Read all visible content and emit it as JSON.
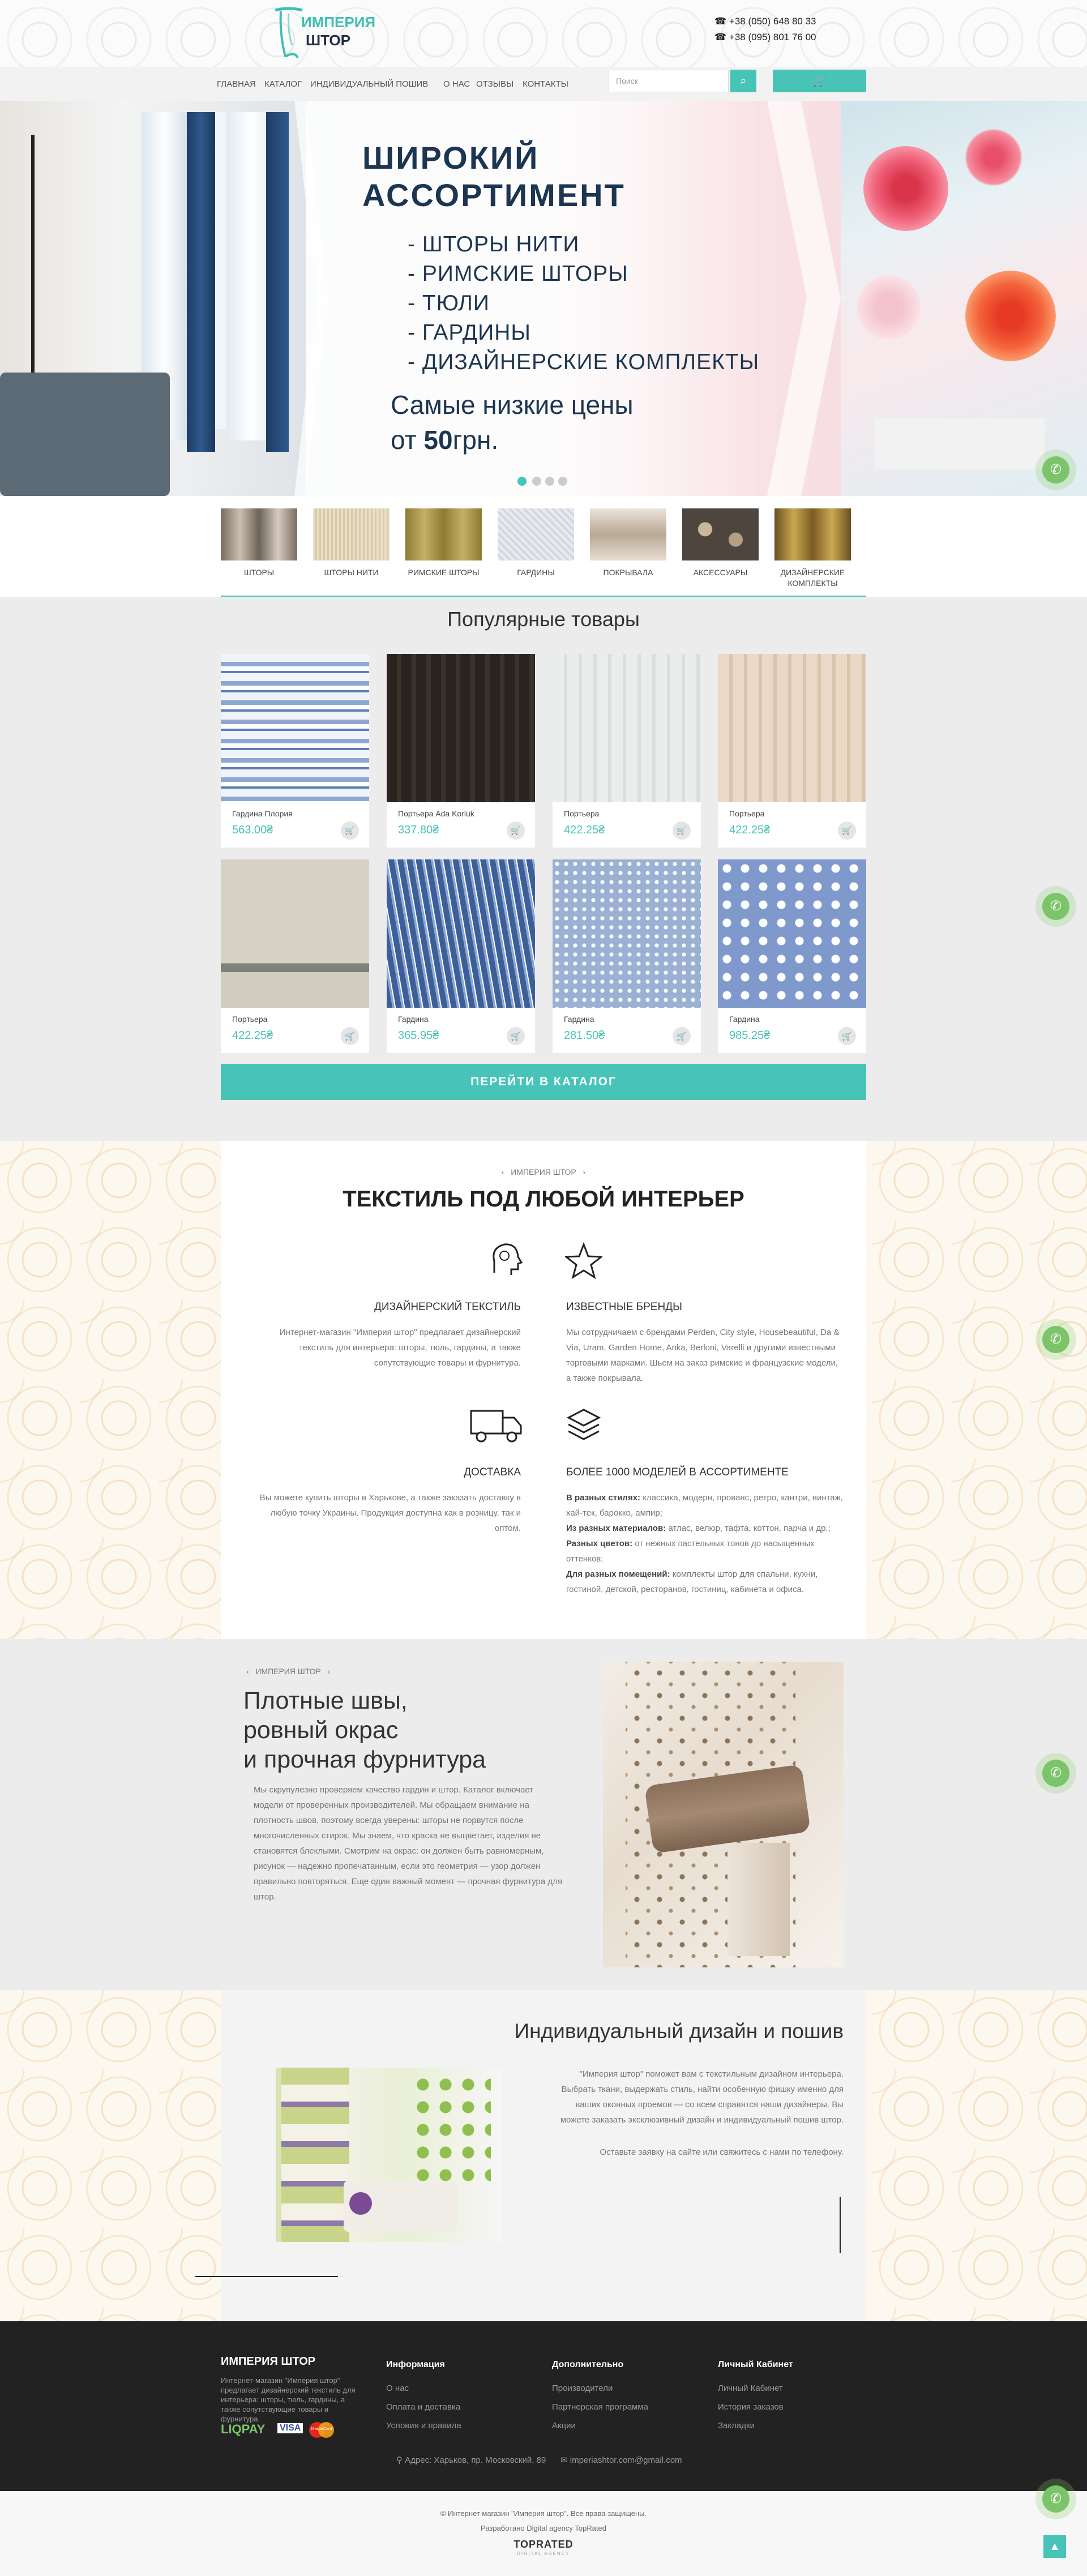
{
  "header": {
    "logo_line1": "ИМПЕРИЯ",
    "logo_line2": "ШТОР",
    "phone1": "+38 (050) 648 80 33",
    "phone2": "+38 (095) 801 76 00"
  },
  "nav": {
    "items": [
      "ГЛАВНАЯ",
      "КАТАЛОГ",
      "ИНДИВИДУАЛЬНЫЙ ПОШИВ",
      "О НАС",
      "ОТЗЫВЫ",
      "КОНТАКТЫ"
    ],
    "search_placeholder": "Поиск",
    "search_icon": "search-icon",
    "cart_icon": "cart-icon"
  },
  "hero": {
    "heading_line1": "ШИРОКИЙ",
    "heading_line2": "АССОРТИМЕНТ",
    "list": [
      "- ШТОРЫ НИТИ",
      "- РИМСКИЕ ШТОРЫ",
      "- ТЮЛИ",
      "- ГАРДИНЫ",
      "- ДИЗАЙНЕРСКИЕ КОМПЛЕКТЫ"
    ],
    "price_line1": "Самые низкие цены",
    "price_line2_prefix": "от ",
    "price_value": "50",
    "price_currency": "грн.",
    "active_slide": 1,
    "slide_count": 4
  },
  "categories": [
    {
      "label": "ШТОРЫ",
      "color": "#8a7d70"
    },
    {
      "label": "ШТОРЫ НИТИ",
      "color": "#e0d3b8"
    },
    {
      "label": "РИМСКИЕ ШТОРЫ",
      "color": "#b9a25a"
    },
    {
      "label": "ГАРДИНЫ",
      "color": "#d9dde3"
    },
    {
      "label": "ПОКРЫВАЛА",
      "color": "#c8b9a8"
    },
    {
      "label": "АКСЕССУАРЫ",
      "color": "#6e6258"
    },
    {
      "label": "ДИЗАЙНЕРСКИЕ КОМПЛЕКТЫ",
      "color": "#9a7a3a"
    }
  ],
  "popular": {
    "title": "Популярные товары",
    "products": [
      {
        "name": "Гардина Плория",
        "price": "563.00₴",
        "color": "#9fb4d6"
      },
      {
        "name": "Портьера Ada Korluk",
        "price": "337.80₴",
        "color": "#2c2725"
      },
      {
        "name": "Портьера",
        "price": "422.25₴",
        "color": "#e3e8e6"
      },
      {
        "name": "Портьера",
        "price": "422.25₴",
        "color": "#e6d6c4"
      },
      {
        "name": "Портьера",
        "price": "422.25₴",
        "color": "#cdc8bc"
      },
      {
        "name": "Гардина",
        "price": "365.95₴",
        "color": "#5b7bb0"
      },
      {
        "name": "Гардина",
        "price": "281.50₴",
        "color": "#a8bcd8"
      },
      {
        "name": "Гардина",
        "price": "985.25₴",
        "color": "#8fa6d2"
      }
    ],
    "catalog_button": "ПЕРЕЙТИ В КАТАЛОГ"
  },
  "textile": {
    "crumb": "ИМПЕРИЯ ШТОР",
    "title": "ТЕКСТИЛЬ ПОД ЛЮБОЙ ИНТЕРЬЕР",
    "features": [
      {
        "icon": "designer-head-icon",
        "title": "ДИЗАЙНЕРСКИЙ ТЕКСТИЛЬ",
        "text": "Интернет-магазин \"Империя штор\" предлагает дизайнерский текстиль для интерьера: шторы, тюль, гардины, а также сопутствующие товары и фурнитура."
      },
      {
        "icon": "star-icon",
        "title": "ИЗВЕСТНЫЕ БРЕНДЫ",
        "text": "Мы сотрудничаем с брендами Perden, City style, Housebeautiful, Da & Via, Uram, Garden Home, Anka, Berloni, Varelli и другими известными торговыми марками. Шьем на заказ римские и французские модели, а также покрывала."
      },
      {
        "icon": "delivery-truck-icon",
        "title": "ДОСТАВКА",
        "text": "Вы можете купить шторы в Харькове, а также заказать доставку в любую точку Украины. Продукция доступна как в розницу, так и оптом."
      },
      {
        "icon": "layers-icon",
        "title": "БОЛЕЕ 1000 МОДЕЛЕЙ В АССОРТИМЕНТЕ"
      }
    ],
    "models": [
      {
        "label": "В разных стилях:",
        "text": " классика, модерн, прованс, ретро, кантри, винтаж, хай-тек, барокко, ампир;"
      },
      {
        "label": "Из разных материалов:",
        "text": " атлас, велюр, тафта, коттон, парча и др.;"
      },
      {
        "label": "Разных цветов:",
        "text": " от нежных пастельных тонов до насыщенных оттенков;"
      },
      {
        "label": "Для разных помещений:",
        "text": " комплекты штор для спальни, кухни, гостиной, детской, ресторанов, гостиниц, кабинета и офиса."
      }
    ]
  },
  "quality": {
    "crumb": "ИМПЕРИЯ ШТОР",
    "title_line1": "Плотные швы,",
    "title_line2": "ровный окрас",
    "title_line3": "и прочная фурнитура",
    "text": "Мы скрупулезно проверяем качество гардин и штор. Каталог включает модели от проверенных производителей. Мы обращаем внимание на плотность швов, поэтому всегда уверены: шторы не порвутся после многочисленных стирок. Мы знаем, что краска не выцветает, изделия не становятся блеклыми. Смотрим на окрас: он должен быть равномерным, рисунок — надежно пропечатанным, если это геометрия — узор должен правильно повторяться. Еще один важный момент — прочная фурнитура для штор."
  },
  "design": {
    "title": "Индивидуальный дизайн и пошив",
    "text": "\"Империя штор\" поможет вам с текстильным дизайном интерьера. Выбрать ткани, выдержать стиль, найти особенную фишку именно для ваших оконных проемов — со всем справятся наши дизайнеры. Вы можете заказать эксклюзивный дизайн и индивидуальный пошив штор.",
    "text2": "Оставьте заявку на сайте или свяжитесь с нами по телефону."
  },
  "footer": {
    "brand": "ИМПЕРИЯ ШТОР",
    "brand_text": "Интернет-магазин \"Империя штор\" предлагает дизайнерский текстиль для интерьера: шторы, тюль, гардины, а также сопутствующие товары и фурнитура.",
    "payment1": "LIQPAY",
    "payment2": "VISA",
    "payment3": "MasterCard",
    "columns": [
      {
        "title": "Информация",
        "links": [
          "О нас",
          "Оплата и доставка",
          "Условия и правила"
        ]
      },
      {
        "title": "Дополнительно",
        "links": [
          "Производители",
          "Партнерская программа",
          "Акции"
        ]
      },
      {
        "title": "Личный Кабинет",
        "links": [
          "Личный Кабинет",
          "История заказов",
          "Закладки"
        ]
      }
    ],
    "address": "Адрес: Харьков, пр. Московский, 89",
    "email": "imperiashtor.com@gmail.com"
  },
  "copyright": {
    "line1": "© Интернет магазин \"Империя штор\". Все права защищены.",
    "line2": "Разработано Digital agency TopRated",
    "logo": "TOPRATED",
    "logo_sub": "DIGITAL AGENCY"
  },
  "colors": {
    "accent": "#48c3b7",
    "navy": "#1c3550",
    "callbtn": "#7cc46a"
  }
}
